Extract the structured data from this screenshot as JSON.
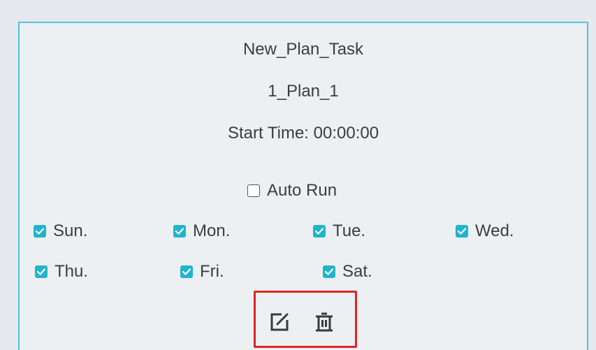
{
  "task": {
    "name": "New_Plan_Task",
    "plan": "1_Plan_1",
    "start_time": "Start Time: 00:00:00"
  },
  "auto_run": {
    "label": "Auto Run",
    "checked": false
  },
  "days": [
    {
      "label": "Sun.",
      "checked": true
    },
    {
      "label": "Mon.",
      "checked": true
    },
    {
      "label": "Tue.",
      "checked": true
    },
    {
      "label": "Wed.",
      "checked": true
    },
    {
      "label": "Thu.",
      "checked": true
    },
    {
      "label": "Fri.",
      "checked": true
    },
    {
      "label": "Sat.",
      "checked": true
    }
  ],
  "actions": {
    "edit_icon": "edit-icon",
    "delete_icon": "trash-icon"
  },
  "colors": {
    "card_border": "#4fc3d9",
    "checkbox_checked": "#22b4cc",
    "highlight_box": "#e02424",
    "background": "#e5e9ed"
  }
}
